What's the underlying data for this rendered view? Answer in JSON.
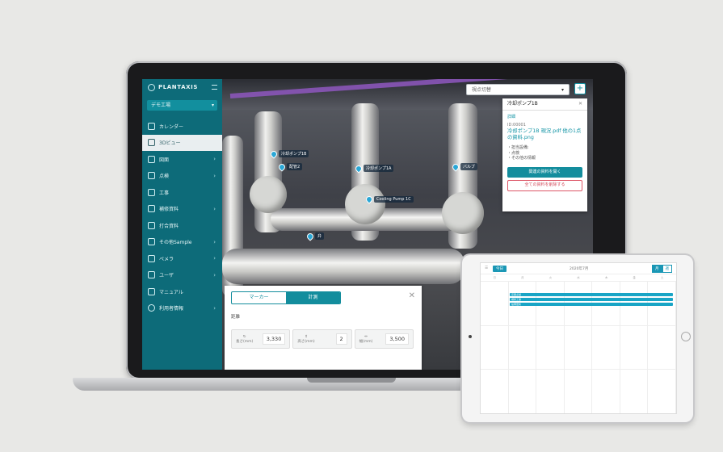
{
  "app": {
    "name": "PLANTAXIS",
    "project_select": "デモ工場",
    "nav": [
      {
        "label": "カレンダー",
        "chevron": false,
        "active": false,
        "icon": "calendar-icon"
      },
      {
        "label": "3Dビュー",
        "chevron": false,
        "active": true,
        "icon": "cube-icon"
      },
      {
        "label": "図面",
        "chevron": true,
        "active": false,
        "icon": "drawing-icon"
      },
      {
        "label": "点検",
        "chevron": true,
        "active": false,
        "icon": "inspection-icon"
      },
      {
        "label": "工事",
        "chevron": false,
        "active": false,
        "icon": "construction-icon"
      },
      {
        "label": "補修資料",
        "chevron": true,
        "active": false,
        "icon": "repair-doc-icon"
      },
      {
        "label": "打合資料",
        "chevron": false,
        "active": false,
        "icon": "meeting-doc-icon"
      },
      {
        "label": "その他Sample",
        "chevron": true,
        "active": false,
        "icon": "folder-icon"
      },
      {
        "label": "ペメラ",
        "chevron": true,
        "active": false,
        "icon": "grid-icon"
      },
      {
        "label": "ユーザ",
        "chevron": true,
        "active": false,
        "icon": "user-icon"
      },
      {
        "label": "マニュアル",
        "chevron": false,
        "active": false,
        "icon": "manual-icon"
      },
      {
        "label": "利用者情報",
        "chevron": true,
        "active": false,
        "icon": "account-icon"
      }
    ]
  },
  "viewpoint": {
    "placeholder": "視点切替",
    "add_label": "+"
  },
  "detail": {
    "title": "冷却ポンプ1B",
    "section": "詳細",
    "id_line": "ID:00001",
    "file_name": "冷却ポンプ1B 現況.pdf 他の1点の資料.png",
    "comment_1": "・担当設備:",
    "comment_2": "・点検",
    "comment_3": "・その他の情報",
    "primary_button": "関連の資料を開く",
    "danger_button": "全ての資料を削除する"
  },
  "measure": {
    "tabs": [
      "マーカー",
      "計測"
    ],
    "active_tab": 1,
    "subtitle": "距離",
    "fields": [
      {
        "label": "長さ(mm)",
        "value": "3,330"
      },
      {
        "label": "高さ(mm)",
        "value": "2"
      },
      {
        "label": "幅(mm)",
        "value": "3,500"
      }
    ]
  },
  "markers": [
    {
      "label": "冷却ポンプ1B"
    },
    {
      "label": "配管2"
    },
    {
      "label": "冷却ポンプ1A"
    },
    {
      "label": "バルブ"
    },
    {
      "label": "Cooling Pump 1C"
    },
    {
      "label": "弁"
    }
  ],
  "tablet_calendar": {
    "today_label": "今日",
    "month": "2020年7月",
    "views": [
      "月",
      "週"
    ],
    "weekdays": [
      "日",
      "月",
      "火",
      "水",
      "木",
      "金",
      "土"
    ],
    "events": [
      "定期点検",
      "補修工事",
      "設備更新"
    ]
  },
  "colors": {
    "teal": "#0d6b79",
    "accent": "#138d9d",
    "danger": "#d24a5b",
    "event": "#19a5c6"
  }
}
